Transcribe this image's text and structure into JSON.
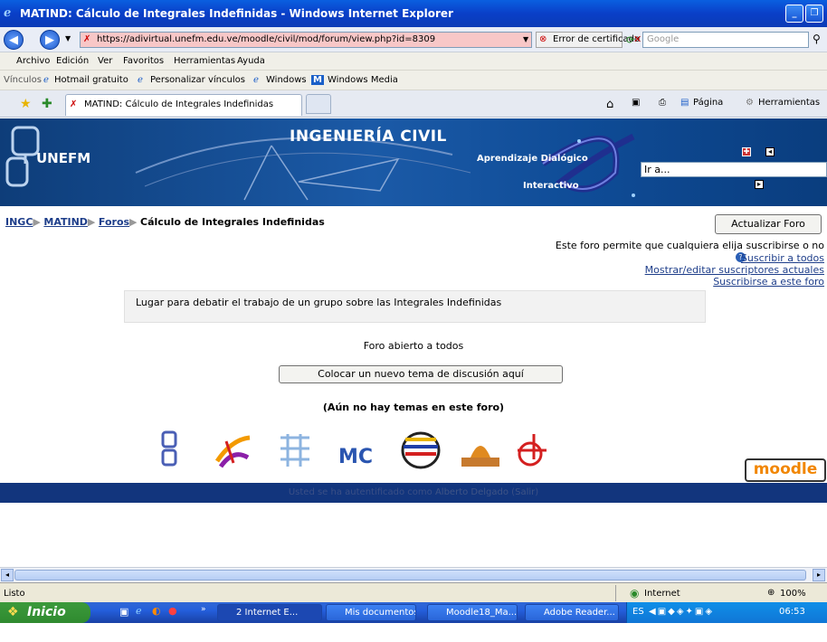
{
  "window": {
    "title": "MATIND: Cálculo de Integrales Indefinidas - Windows Internet Explorer"
  },
  "address": {
    "url": "https://adivirtual.unefm.edu.ve/moodle/civil/mod/forum/view.php?id=8309",
    "cert_error": "Error de certificado",
    "search_placeholder": "Google"
  },
  "menu": [
    "Archivo",
    "Edición",
    "Ver",
    "Favoritos",
    "Herramientas",
    "Ayuda"
  ],
  "links": {
    "label": "Vínculos",
    "items": [
      "Hotmail gratuito",
      "Personalizar vínculos",
      "Windows",
      "Windows Media"
    ]
  },
  "tab": {
    "label": "MATIND: Cálculo de Integrales Indefinidas"
  },
  "toolbar_right": {
    "page": "Página",
    "tools": "Herramientas"
  },
  "banner": {
    "title": "INGENIERÍA CIVIL",
    "org": "UNEFM",
    "line1": "Aprendizaje Dialógico",
    "line2": "Interactivo",
    "jump": "Ir a..."
  },
  "breadcrumb": {
    "items": [
      "INGC",
      "MATIND",
      "Foros"
    ],
    "current": "Cálculo de Integrales Indefinidas"
  },
  "forum": {
    "update_button": "Actualizar Foro",
    "subscription_info": "Este foro permite que cualquiera elija suscribirse o no",
    "subscribe_all": "Suscribir a todos",
    "show_subscribers": "Mostrar/editar suscriptores actuales",
    "subscribe_this": "Suscribirse a este foro",
    "intro": "Lugar para debatir el trabajo de un grupo sobre las Integrales Indefinidas",
    "open_to_all": "Foro abierto a todos",
    "new_topic_button": "Colocar un nuevo tema de discusión aquí",
    "no_topics": "(Aún no hay temas en este foro)"
  },
  "footer": {
    "prefix": "Usted se ha autentificado como",
    "user": "Alberto Delgado",
    "logout": "Salir",
    "moodle_logo": "moodle"
  },
  "status": {
    "left": "Listo",
    "zone": "Internet",
    "zoom": "100%"
  },
  "taskbar": {
    "start": "Inicio",
    "tasks": [
      "2 Internet E...",
      "Mis documentos",
      "Moodle18_Ma...",
      "Adobe Reader..."
    ],
    "lang": "ES",
    "clock": "06:53 p.m."
  }
}
